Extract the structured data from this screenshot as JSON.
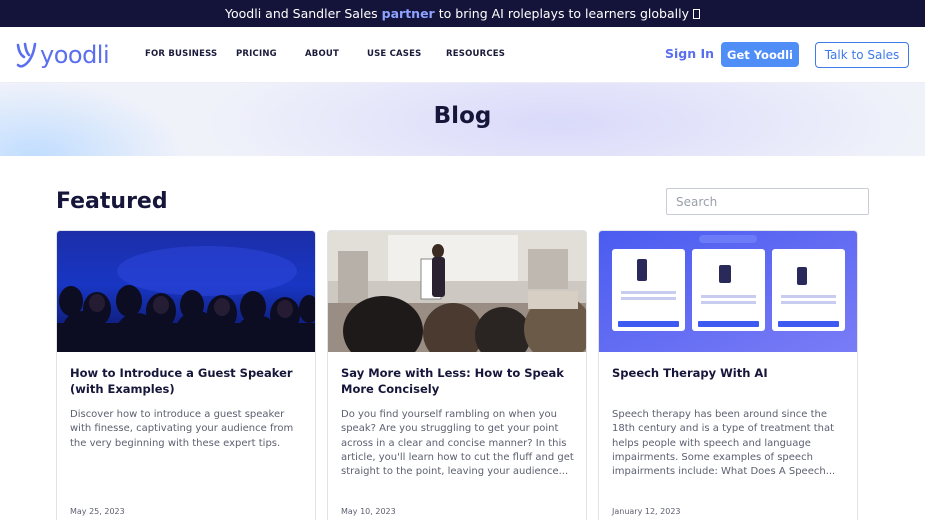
{
  "banner": {
    "prefix": "Yoodli and Sandler Sales",
    "highlight": "partner",
    "suffix": "to bring AI roleplays to learners globally",
    "icon": "emoji-glyph"
  },
  "brand": {
    "name": "yoodli",
    "color": "#5a6ff0",
    "icon": "yoodli-y-logo"
  },
  "nav": {
    "links": [
      "FOR BUSINESS",
      "PRICING",
      "ABOUT",
      "USE CASES",
      "RESOURCES"
    ],
    "sign_in": "Sign In",
    "get_yoodli": "Get Yoodli",
    "talk_to_sales": "Talk to Sales"
  },
  "hero": {
    "title": "Blog"
  },
  "featured": {
    "heading": "Featured",
    "search_placeholder": "Search"
  },
  "posts": [
    {
      "title": "How to Introduce a Guest Speaker (with Examples)",
      "excerpt": "Discover how to introduce a guest speaker with finesse, captivating your audience from the very beginning with these expert tips.",
      "date": "May 25, 2023",
      "image": "audience-in-auditorium-photo"
    },
    {
      "title": "Say More with Less: How to Speak More Concisely",
      "excerpt": "Do you find yourself rambling on when you speak? Are you struggling to get your point across in a clear and concise manner? In this article, you'll learn how to cut the fluff and get straight to the point, leaving your audience...",
      "date": "May 10, 2023",
      "image": "speaker-presenting-to-room-photo"
    },
    {
      "title": "Speech Therapy With AI",
      "excerpt": "Speech therapy has been around since the 18th century and is a type of treatment that helps people with speech and language impairments. Some examples of speech impairments include: What Does A Speech...",
      "date": "January 12, 2023",
      "image": "app-feature-cards-illustration"
    }
  ],
  "colors": {
    "banner_bg": "#14143a",
    "accent_blue": "#4f8ef7",
    "highlight": "#8ea2ff",
    "text_dark": "#16163a"
  }
}
